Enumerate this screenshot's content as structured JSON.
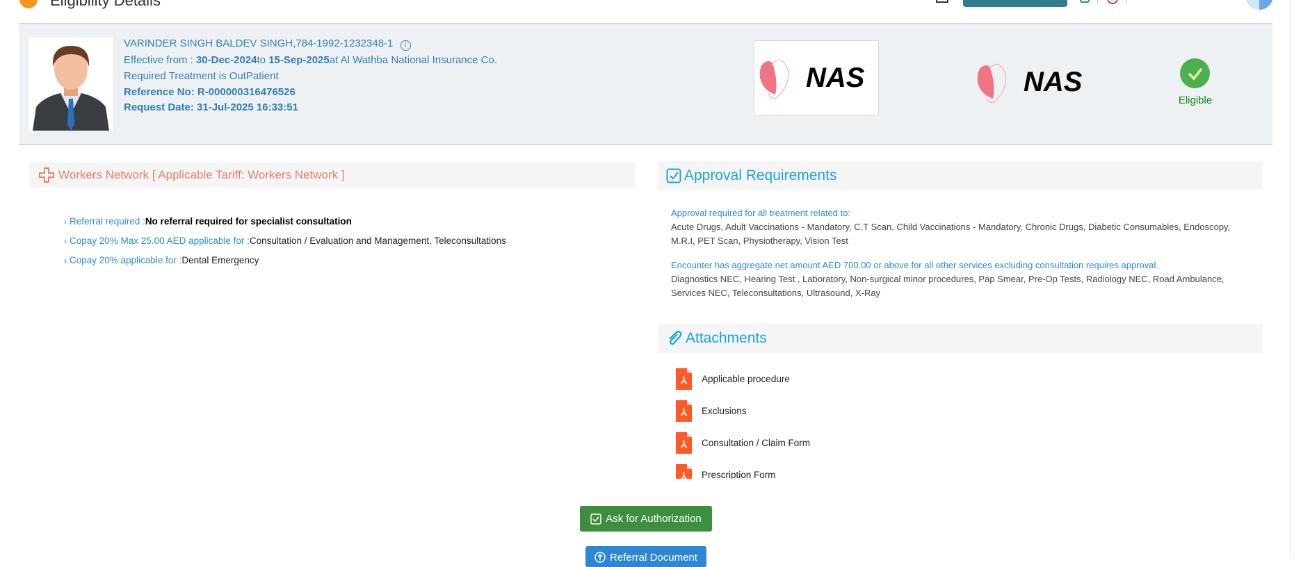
{
  "header": {
    "title": "Eligibility Details"
  },
  "member": {
    "name_line": "VARINDER SINGH BALDEV SINGH,784-1992-1232348-1",
    "effective_label": "Effective from : ",
    "effective_from": "30-Dec-2024",
    "to_label": "to ",
    "effective_to": "15-Sep-2025",
    "insurer": "at Al Wathba National Insurance Co.",
    "treatment": "Required Treatment is OutPatient",
    "reference": "Reference No: R-000000316476526",
    "request_date": "Request Date: 31-Jul-2025 16:33:51"
  },
  "logos": {
    "payer": "NAS",
    "tpa": "NAS"
  },
  "status": {
    "label": "Eligible",
    "color": "#4caf50"
  },
  "network": {
    "title": "Workers Network [ Applicable Tariff: Workers Network ]",
    "items": [
      {
        "label": "Referral required :",
        "value": "No referral required for specialist consultation"
      },
      {
        "label": "Copay 20% Max 25.00 AED applicable for :",
        "value": "Consultation / Evaluation and Management, Teleconsultations"
      },
      {
        "label": "Copay 20% applicable for :",
        "value": "Dental Emergency"
      }
    ]
  },
  "approval": {
    "title": "Approval Requirements",
    "intro1": "Approval required for all treatment related to:",
    "list1": "Acute Drugs, Adult Vaccinations - Mandatory, C.T Scan, Child Vaccinations - Mandatory, Chronic Drugs, Diabetic Consumables, Endoscopy, M.R.I, PET Scan, Physiotherapy, Vision Test",
    "intro2": "Encounter has aggregate net amount AED 700.00 or above for all other services excluding consultation requires approval.",
    "list2": "Diagnostics NEC, Hearing Test , Laboratory, Non-surgical minor procedures, Pap Smear, Pre-Op Tests, Radiology NEC, Road Ambulance, Services NEC, Teleconsultations, Ultrasound, X-Ray"
  },
  "attachments": {
    "title": "Attachments",
    "items": [
      "Applicable procedure",
      "Exclusions",
      "Consultation / Claim Form",
      "Prescription Form"
    ]
  },
  "actions": {
    "ask_authorization": "Ask for Authorization",
    "referral_document": "Referral Document"
  }
}
